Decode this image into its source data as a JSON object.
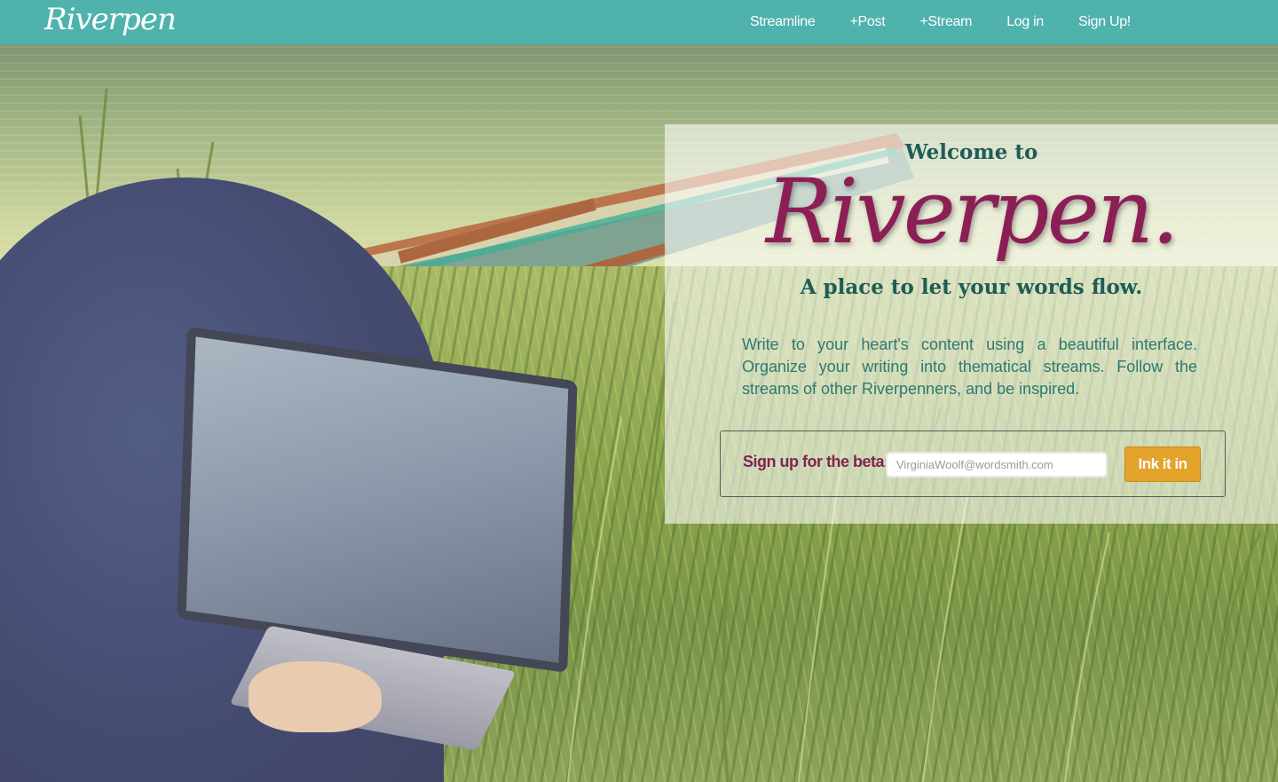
{
  "navbar": {
    "brand": "Riverpen",
    "links": [
      {
        "label": "Streamline"
      },
      {
        "label": "+Post"
      },
      {
        "label": "+Stream"
      },
      {
        "label": "Log in"
      },
      {
        "label": "Sign Up!"
      }
    ]
  },
  "hero": {
    "welcome": "Welcome to",
    "logo": "Riverpen.",
    "tagline": "A place to let your words flow.",
    "intro": "Write to your heart's content using a beautiful interface. Organize your writing into thematical streams. Follow the streams of other Riverpenners, and be inspired."
  },
  "signup": {
    "label": "Sign up for the beta:",
    "email_placeholder": "VirginiaWoolf@wordsmith.com",
    "email_value": "",
    "button_label": "Ink it in"
  },
  "colors": {
    "navbar": "#4fb2ad",
    "brand_magenta": "#8c1e56",
    "teal_text": "#1e5d55",
    "button": "#e3a32a"
  },
  "background": {
    "image_description_icon": "photo-background"
  }
}
